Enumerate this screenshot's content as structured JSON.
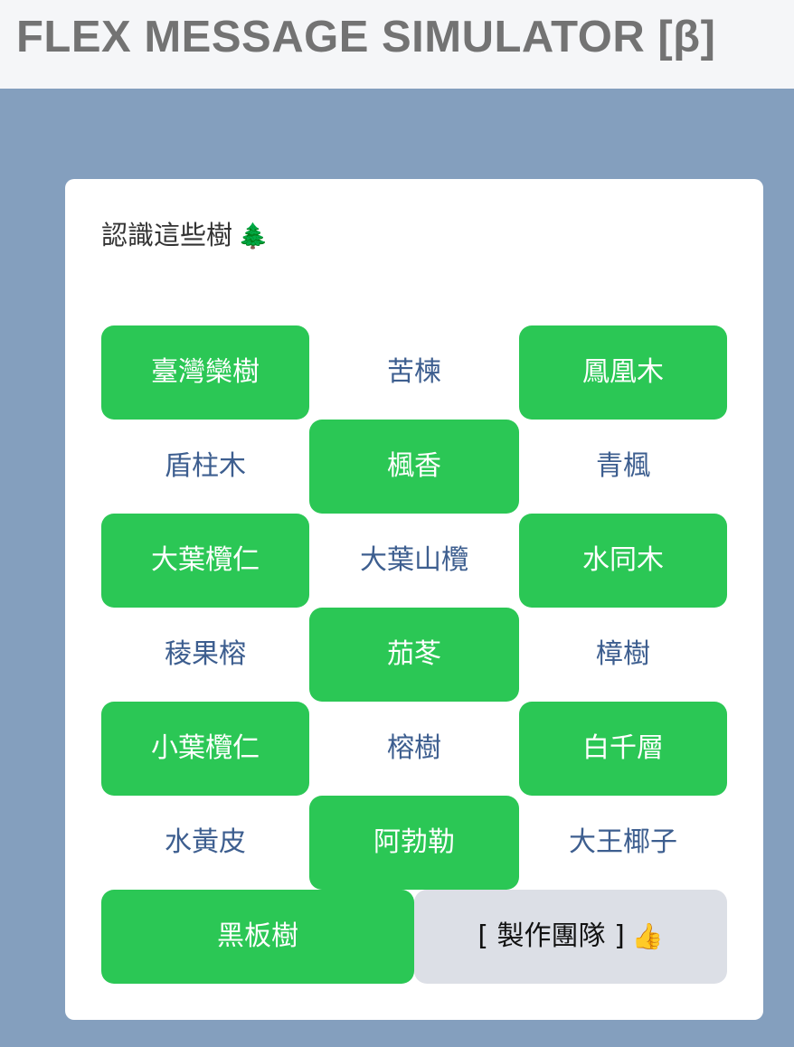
{
  "header": {
    "title": "FLEX MESSAGE SIMULATOR [β]"
  },
  "card": {
    "title": "認識這些樹",
    "title_emoji": "🌲",
    "rows": [
      [
        "臺灣欒樹",
        "苦楝",
        "鳳凰木"
      ],
      [
        "盾柱木",
        "楓香",
        "青楓"
      ],
      [
        "大葉欖仁",
        "大葉山欖",
        "水同木"
      ],
      [
        "稜果榕",
        "茄苳",
        "樟樹"
      ],
      [
        "小葉欖仁",
        "榕樹",
        "白千層"
      ],
      [
        "水黃皮",
        "阿勃勒",
        "大王椰子"
      ]
    ],
    "last_row": {
      "primary": "黑板樹",
      "secondary": "[ 製作團隊 ]",
      "secondary_emoji": "👍"
    }
  },
  "colors": {
    "background": "#849fbe",
    "primary_button": "#2bc755",
    "link_text": "#3d5e8f",
    "secondary_button": "#dcdfe6"
  }
}
